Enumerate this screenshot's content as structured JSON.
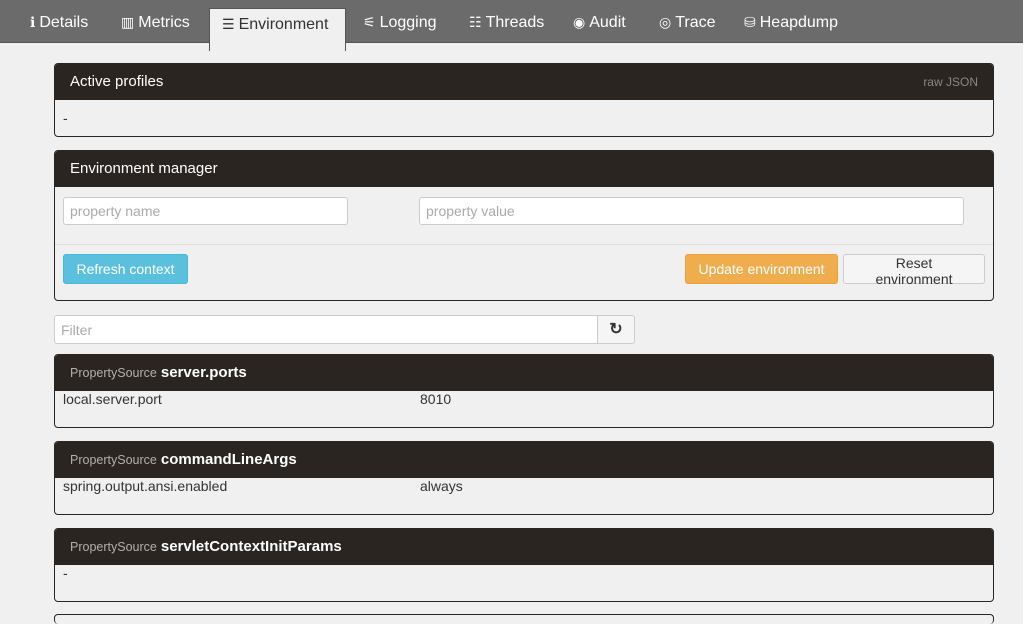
{
  "tabs": [
    {
      "label": "Details",
      "icon": "info-icon",
      "glyph": "ℹ"
    },
    {
      "label": "Metrics",
      "icon": "bar-chart-icon",
      "glyph": "▥"
    },
    {
      "label": "Environment",
      "icon": "server-list-icon",
      "glyph": "☰"
    },
    {
      "label": "Logging",
      "icon": "sliders-icon",
      "glyph": "⚟"
    },
    {
      "label": "Threads",
      "icon": "list-icon",
      "glyph": "☷"
    },
    {
      "label": "Audit",
      "icon": "user-circle-icon",
      "glyph": "◉"
    },
    {
      "label": "Trace",
      "icon": "eye-icon",
      "glyph": "◎"
    },
    {
      "label": "Heapdump",
      "icon": "cubes-icon",
      "glyph": "⛁"
    }
  ],
  "active_profiles": {
    "title": "Active profiles",
    "raw_json": "raw JSON",
    "value": "-"
  },
  "env_manager": {
    "title": "Environment manager",
    "name_placeholder": "property name",
    "value_placeholder": "property value",
    "refresh_label": "Refresh context",
    "update_label": "Update environment",
    "reset_label": "Reset environment"
  },
  "filter": {
    "placeholder": "Filter",
    "refresh_icon": "refresh-icon",
    "glyph": "↻"
  },
  "property_sources": [
    {
      "label": "PropertySource",
      "name": "server.ports",
      "rows": [
        {
          "key": "local.server.port",
          "value": "8010"
        }
      ]
    },
    {
      "label": "PropertySource",
      "name": "commandLineArgs",
      "rows": [
        {
          "key": "spring.output.ansi.enabled",
          "value": "always"
        }
      ]
    },
    {
      "label": "PropertySource",
      "name": "servletContextInitParams",
      "empty": "-"
    }
  ]
}
